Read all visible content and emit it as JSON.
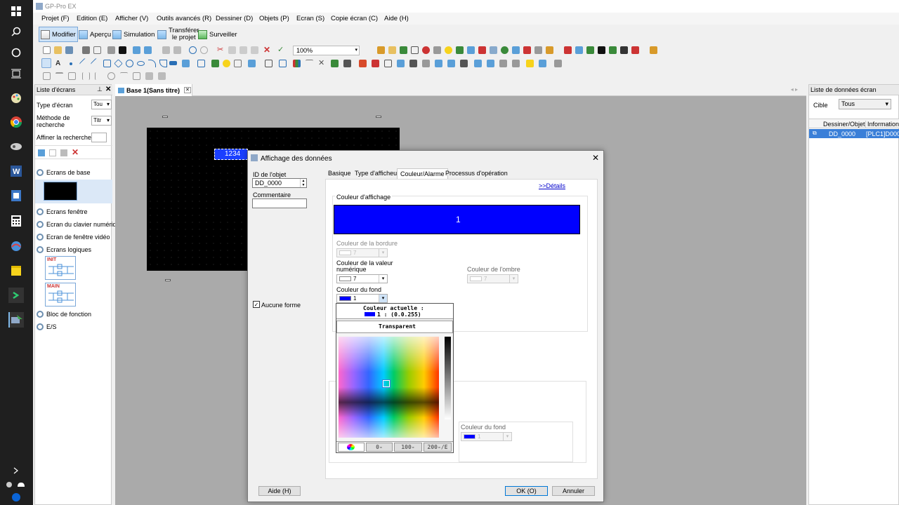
{
  "taskbar": {
    "icons": [
      "windows-icon",
      "search-icon",
      "cortana-icon",
      "task-view-icon",
      "paint-icon",
      "chrome-icon",
      "snipping-icon",
      "word-icon",
      "document-icon",
      "calculator-icon",
      "network-icon",
      "sticky-notes-icon",
      "terminal-icon",
      "gp-pro-icon"
    ],
    "bottom_time": ""
  },
  "app": {
    "title": "GP-Pro EX",
    "menu": [
      "Projet (F)",
      "Edition (E)",
      "Afficher (V)",
      "Outils avancés (R)",
      "Dessiner (D)",
      "Objets (P)",
      "Ecran (S)",
      "Copie écran (C)",
      "Aide (H)"
    ],
    "mainbar": {
      "modify": "Modifier",
      "preview": "Aperçu",
      "simulation": "Simulation",
      "transfer_line1": "Transférer",
      "transfer_line2": "le projet",
      "monitor": "Surveiller"
    },
    "zoom": "100%"
  },
  "left_panel": {
    "title": "Liste d'écrans",
    "screen_type_label": "Type d'écran",
    "screen_type_value": "Tou",
    "search_method_label_1": "Méthode de",
    "search_method_label_2": "recherche",
    "search_method_value": "Titr",
    "refine_label": "Affiner la recherche",
    "tree": {
      "base_screens": "Ecrans de base",
      "window_screens": "Ecrans fenêtre",
      "keypad_screen": "Ecran du clavier numériq",
      "video_window": "Ecran de fenêtre vidéo",
      "logic_screens": "Ecrans logiques",
      "logic_init": "INIT",
      "logic_main": "MAIN",
      "function_block": "Bloc de fonction",
      "io": "E/S"
    }
  },
  "editor": {
    "tab_label": "Base 1(Sans titre)",
    "canvas_object_text": "1234"
  },
  "right_panel": {
    "title": "Liste de données écran",
    "target_label": "Cible",
    "target_value": "Tous",
    "columns": [
      "Dessiner/Objet",
      "Informations"
    ],
    "rows": [
      {
        "object": "DD_0000",
        "info": "[PLC1]D0000"
      }
    ]
  },
  "dialog": {
    "title": "Affichage des données",
    "object_id_label": "ID de l'objet",
    "object_id_value": "DD_0000",
    "comment_label": "Commentaire",
    "comment_value": "",
    "no_shape_label": "Aucune forme",
    "no_shape_checked": true,
    "tabs": [
      "Basique",
      "Type d'afficheur",
      "Couleur/Alarme",
      "Processus d'opération"
    ],
    "active_tab": "Couleur/Alarme",
    "details_link": ">>Détails",
    "display_color_label": "Couleur d'affichage",
    "display_color_preview_text": "1",
    "display_color_hex": "#0000ff",
    "border_color_label": "Couleur de la bordure",
    "border_color_value": "7",
    "numeric_color_label_1": "Couleur de la valeur",
    "numeric_color_label_2": "numérique",
    "numeric_color_value": "7",
    "shadow_color_label": "Couleur de l'ombre",
    "shadow_color_value": "7",
    "bg_color_label": "Couleur du fond",
    "bg_color_value": "1",
    "bg_color_label_2": "Couleur du fond",
    "bg_color_value_2": "1",
    "help_button": "Aide (H)",
    "ok_button": "OK (O)",
    "cancel_button": "Annuler"
  },
  "color_picker": {
    "current_label": "Couleur actuelle :",
    "current_value": "1 : (0.0.255)",
    "transparent_label": "Transparent",
    "tabs": [
      "0-",
      "100-",
      "200-/E"
    ]
  }
}
